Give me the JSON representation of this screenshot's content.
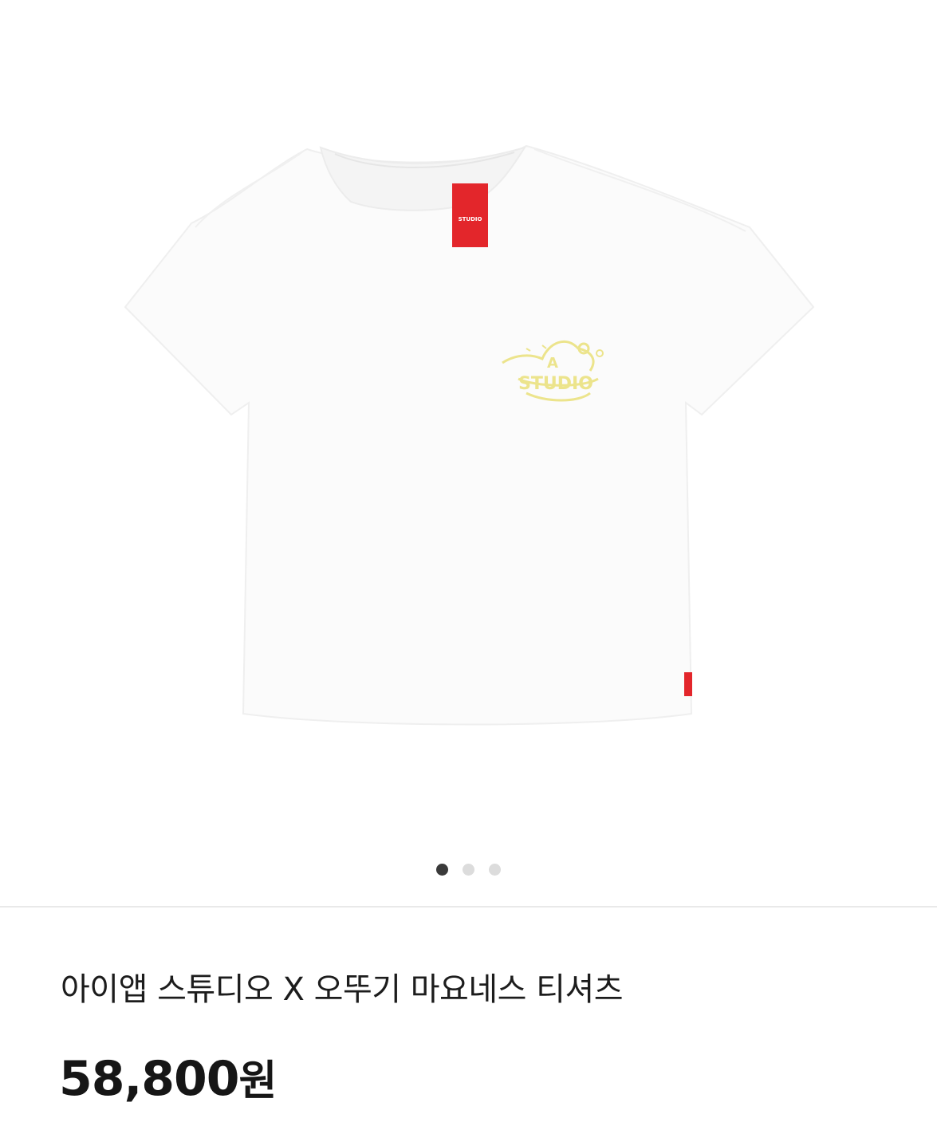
{
  "gallery": {
    "image_alt": "white t-shirt",
    "logo_print": {
      "letter": "A",
      "word": "STUDIO",
      "color": "#ece48c"
    },
    "neck_label": {
      "word": "STUDIO",
      "color": "#e3262b"
    },
    "pager": {
      "total": 3,
      "active_index": 0
    }
  },
  "product": {
    "title": "아이앱 스튜디오 X 오뚜기 마요네스 티셔츠",
    "price_number": "58,800",
    "price_unit": "원"
  },
  "colors": {
    "background": "#ffffff",
    "divider": "#e9e9e9",
    "dot_active": "#3a3a3a",
    "dot_inactive": "#dcdcdc",
    "label_red": "#e3262b"
  }
}
